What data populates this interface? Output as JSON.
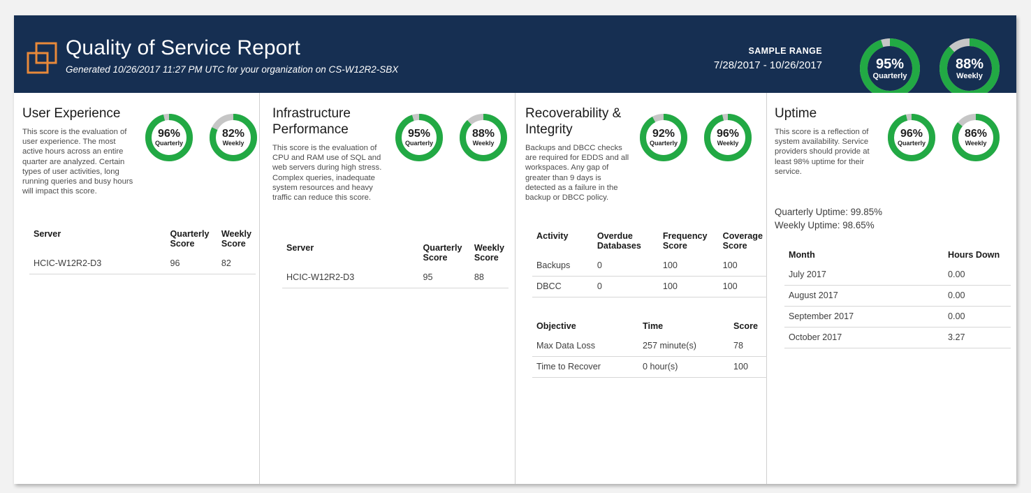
{
  "header": {
    "logo_icon": "two-overlapping-squares-icon",
    "title": "Quality of Service Report",
    "subtitle": "Generated 10/26/2017 11:27 PM UTC for your organization on CS-W12R2-SBX",
    "sample_range_label": "SAMPLE RANGE",
    "sample_range_value": "7/28/2017 - 10/26/2017",
    "donuts": [
      {
        "value": 95,
        "pct_label": "95%",
        "period": "Quarterly"
      },
      {
        "value": 88,
        "pct_label": "88%",
        "period": "Weekly"
      }
    ]
  },
  "colors": {
    "navy": "#162f52",
    "orange": "#e8893a",
    "green": "#22a944",
    "gray_track": "#c6c6c6",
    "page_background": "#f2f2f2",
    "card_background": "#ffffff",
    "divider": "#cfcfcf"
  },
  "panels": [
    {
      "id": "user-experience",
      "heading": "User Experience",
      "description": "This score is the evaluation of user experience. The most active hours across an entire quarter are analyzed. Certain types of user activities, long running queries and busy hours will impact this score.",
      "donuts": [
        {
          "value": 96,
          "pct_label": "96%",
          "period": "Quarterly"
        },
        {
          "value": 82,
          "pct_label": "82%",
          "period": "Weekly"
        }
      ],
      "table": {
        "headers": [
          "Server",
          "Quarterly Score",
          "Weekly Score"
        ],
        "rows": [
          [
            "HCIC-W12R2-D3",
            "96",
            "82"
          ]
        ]
      }
    },
    {
      "id": "infrastructure-performance",
      "heading": "Infrastructure Performance",
      "description": "This score is the evaluation of CPU and RAM use of SQL and web servers during high stress. Complex queries, inadequate system resources and heavy traffic can reduce this score.",
      "donuts": [
        {
          "value": 95,
          "pct_label": "95%",
          "period": "Quarterly"
        },
        {
          "value": 88,
          "pct_label": "88%",
          "period": "Weekly"
        }
      ],
      "table": {
        "headers": [
          "Server",
          "Quarterly Score",
          "Weekly Score"
        ],
        "rows": [
          [
            "HCIC-W12R2-D3",
            "95",
            "88"
          ]
        ]
      }
    },
    {
      "id": "recoverability-integrity",
      "heading": "Recoverability & Integrity",
      "description": "Backups and DBCC checks are required for EDDS and all workspaces. Any gap of greater than 9 days is detected as a failure in the backup or DBCC policy.",
      "donuts": [
        {
          "value": 92,
          "pct_label": "92%",
          "period": "Quarterly"
        },
        {
          "value": 96,
          "pct_label": "96%",
          "period": "Weekly"
        }
      ],
      "activity_table": {
        "headers": [
          "Activity",
          "Overdue Databases",
          "Frequency Score",
          "Coverage Score"
        ],
        "rows": [
          [
            "Backups",
            "0",
            "100",
            "100"
          ],
          [
            "DBCC",
            "0",
            "100",
            "100"
          ]
        ]
      },
      "objective_table": {
        "headers": [
          "Objective",
          "Time",
          "Score"
        ],
        "rows": [
          [
            "Max Data Loss",
            "257 minute(s)",
            "78"
          ],
          [
            "Time to Recover",
            "0 hour(s)",
            "100"
          ]
        ]
      }
    },
    {
      "id": "uptime",
      "heading": "Uptime",
      "description": "This score is a reflection of system availability. Service providers should provide at least 98% uptime for their service.",
      "donuts": [
        {
          "value": 96,
          "pct_label": "96%",
          "period": "Quarterly"
        },
        {
          "value": 86,
          "pct_label": "86%",
          "period": "Weekly"
        }
      ],
      "summary": [
        "Quarterly Uptime: 99.85%",
        "Weekly Uptime: 98.65%"
      ],
      "table": {
        "headers": [
          "Month",
          "Hours Down"
        ],
        "rows": [
          [
            "July 2017",
            "0.00"
          ],
          [
            "August 2017",
            "0.00"
          ],
          [
            "September 2017",
            "0.00"
          ],
          [
            "October 2017",
            "3.27"
          ]
        ]
      }
    }
  ]
}
